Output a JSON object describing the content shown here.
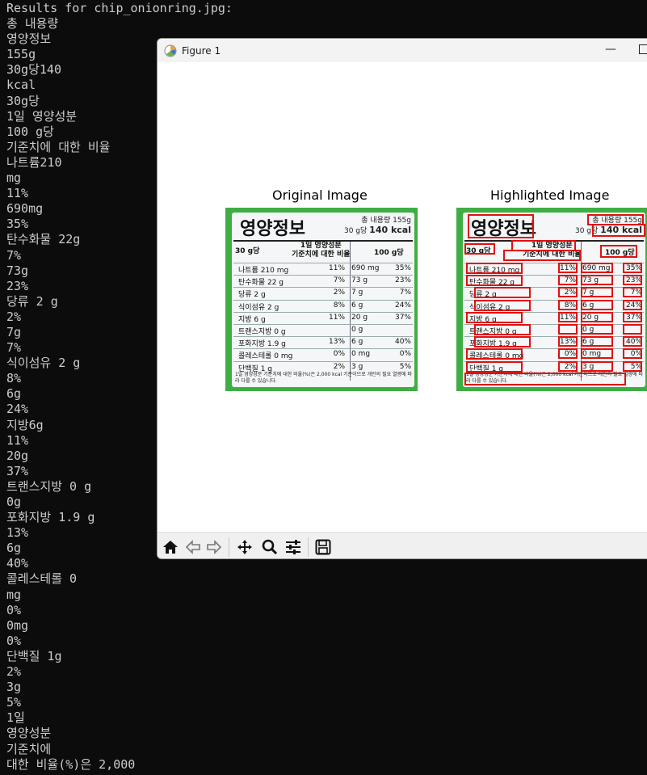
{
  "terminal": {
    "lines": [
      "Results for chip_onionring.jpg:",
      "총 내용량",
      "영양정보",
      "155g",
      "30g당140",
      "kcal",
      "30g당",
      "1일 영양성분",
      "100 g당",
      "기준치에 대한 비율",
      "나트륨210",
      "mg",
      "11%",
      "690mg",
      "35%",
      "탄수화물 22g",
      "7%",
      "73g",
      "23%",
      "당류 2 g",
      "2%",
      "7g",
      "7%",
      "식이섬유 2 g",
      "8%",
      "6g",
      "24%",
      "지방6g",
      "11%",
      "20g",
      "37%",
      "트랜스지방 0 g",
      "0g",
      "포화지방 1.9 g",
      "13%",
      "6g",
      "40%",
      "콜레스테롤 0",
      "mg",
      "0%",
      "0mg",
      "0%",
      "단백질 1g",
      "2%",
      "3g",
      "5%",
      "1일",
      "영양성분",
      "기준치에",
      "대한 비율(%)은 2,000"
    ]
  },
  "figure": {
    "window_title": "Figure 1",
    "minimize_glyph": "—",
    "left_title": "Original Image",
    "right_title": "Highlighted Image"
  },
  "label": {
    "heading": "영양정보",
    "net_line1": "총 내용량 155g",
    "net_line2a": "30 g당",
    "net_line2b": "140 kcal",
    "col1": "30 g당",
    "col2a": "1일 영양성분",
    "col2b": "기준치에 대한 비율",
    "col3": "100 g당",
    "rows": [
      {
        "name": "나트륨 210 mg",
        "pct1": "11%",
        "amt": "690 mg",
        "pct2": "35%"
      },
      {
        "name": "탄수화물 22 g",
        "pct1": "7%",
        "amt": "73 g",
        "pct2": "23%"
      },
      {
        "name": "  당류 2 g",
        "pct1": "2%",
        "amt": "7 g",
        "pct2": "7%"
      },
      {
        "name": "  식이섬유 2 g",
        "pct1": "8%",
        "amt": "6 g",
        "pct2": "24%"
      },
      {
        "name": "지방 6 g",
        "pct1": "11%",
        "amt": "20 g",
        "pct2": "37%"
      },
      {
        "name": "  트랜스지방 0 g",
        "pct1": "",
        "amt": "0 g",
        "pct2": ""
      },
      {
        "name": "  포화지방 1.9 g",
        "pct1": "13%",
        "amt": "6 g",
        "pct2": "40%"
      },
      {
        "name": "콜레스테롤 0 mg",
        "pct1": "0%",
        "amt": "0 mg",
        "pct2": "0%"
      },
      {
        "name": "단백질 1 g",
        "pct1": "2%",
        "amt": "3 g",
        "pct2": "5%"
      }
    ],
    "footnote": "1일 영양성분 기준치에 대한 비율(%)은 2,000 kcal 기준이므로 개인의 필요 열량에 따라 다를 수 있습니다."
  },
  "colors": {
    "terminal_bg": "#0c0c0c",
    "terminal_fg": "#cccccc",
    "package_green": "#3eae44",
    "highlight_red": "#e01010"
  },
  "icons": [
    "matplotlib-icon",
    "home-icon",
    "back-icon",
    "forward-icon",
    "pan-icon",
    "zoom-icon",
    "configure-subplots-icon",
    "save-icon"
  ]
}
